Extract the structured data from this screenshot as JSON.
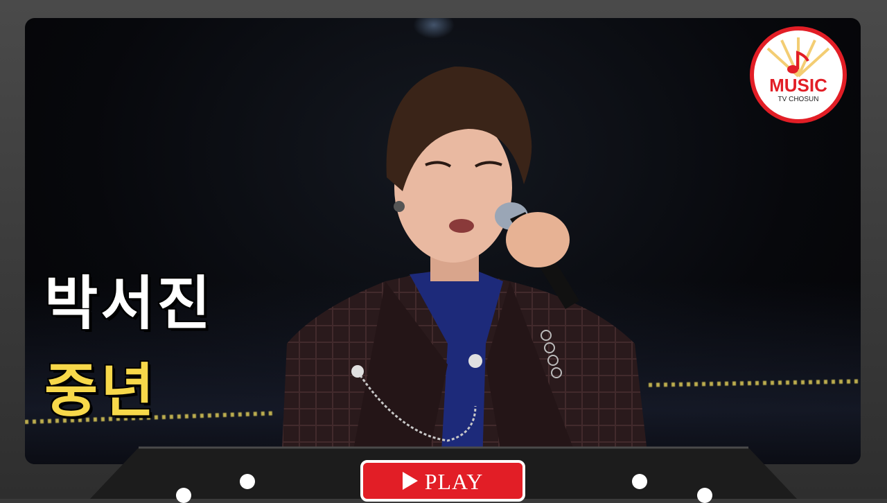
{
  "overlay": {
    "artist_name": "박서진",
    "song_title": "중년"
  },
  "logo": {
    "main_text": "MUSIC",
    "sub_text": "TV CHOSUN"
  },
  "controls": {
    "play_label": "PLAY",
    "play_icon": "play-triangle-icon"
  },
  "colors": {
    "brand_red": "#e21e26",
    "title_yellow": "#f7d84a",
    "title_white": "#ffffff"
  }
}
